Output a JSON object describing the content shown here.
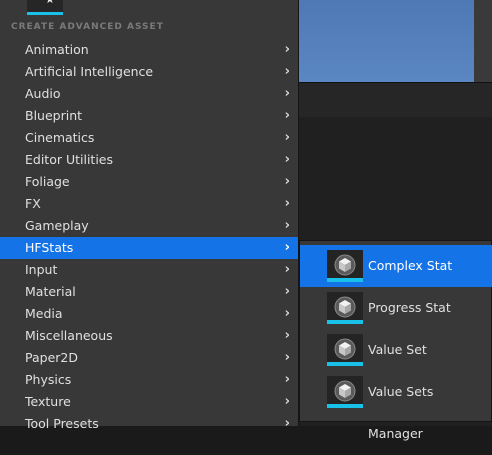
{
  "menu": {
    "top_item_partial": "...",
    "section_header": "CREATE ADVANCED ASSET",
    "items": [
      {
        "label": "Animation"
      },
      {
        "label": "Artificial Intelligence"
      },
      {
        "label": "Audio"
      },
      {
        "label": "Blueprint"
      },
      {
        "label": "Cinematics"
      },
      {
        "label": "Editor Utilities"
      },
      {
        "label": "Foliage"
      },
      {
        "label": "FX"
      },
      {
        "label": "Gameplay"
      },
      {
        "label": "HFStats",
        "selected": true
      },
      {
        "label": "Input"
      },
      {
        "label": "Material"
      },
      {
        "label": "Media"
      },
      {
        "label": "Miscellaneous"
      },
      {
        "label": "Paper2D"
      },
      {
        "label": "Physics"
      },
      {
        "label": "Texture"
      },
      {
        "label": "Tool Presets"
      }
    ],
    "arrow_glyph": "›"
  },
  "submenu": {
    "items": [
      {
        "label": "Complex Stat",
        "icon": "cube-icon",
        "selected": true
      },
      {
        "label": "Progress Stat",
        "icon": "cube-icon"
      },
      {
        "label": "Value Set",
        "icon": "cube-icon"
      },
      {
        "label": "Value Sets Manager",
        "icon": "cube-icon"
      }
    ]
  },
  "colors": {
    "selection": "#1473e6",
    "accent": "#19c0e8",
    "menu_bg": "#383838"
  }
}
